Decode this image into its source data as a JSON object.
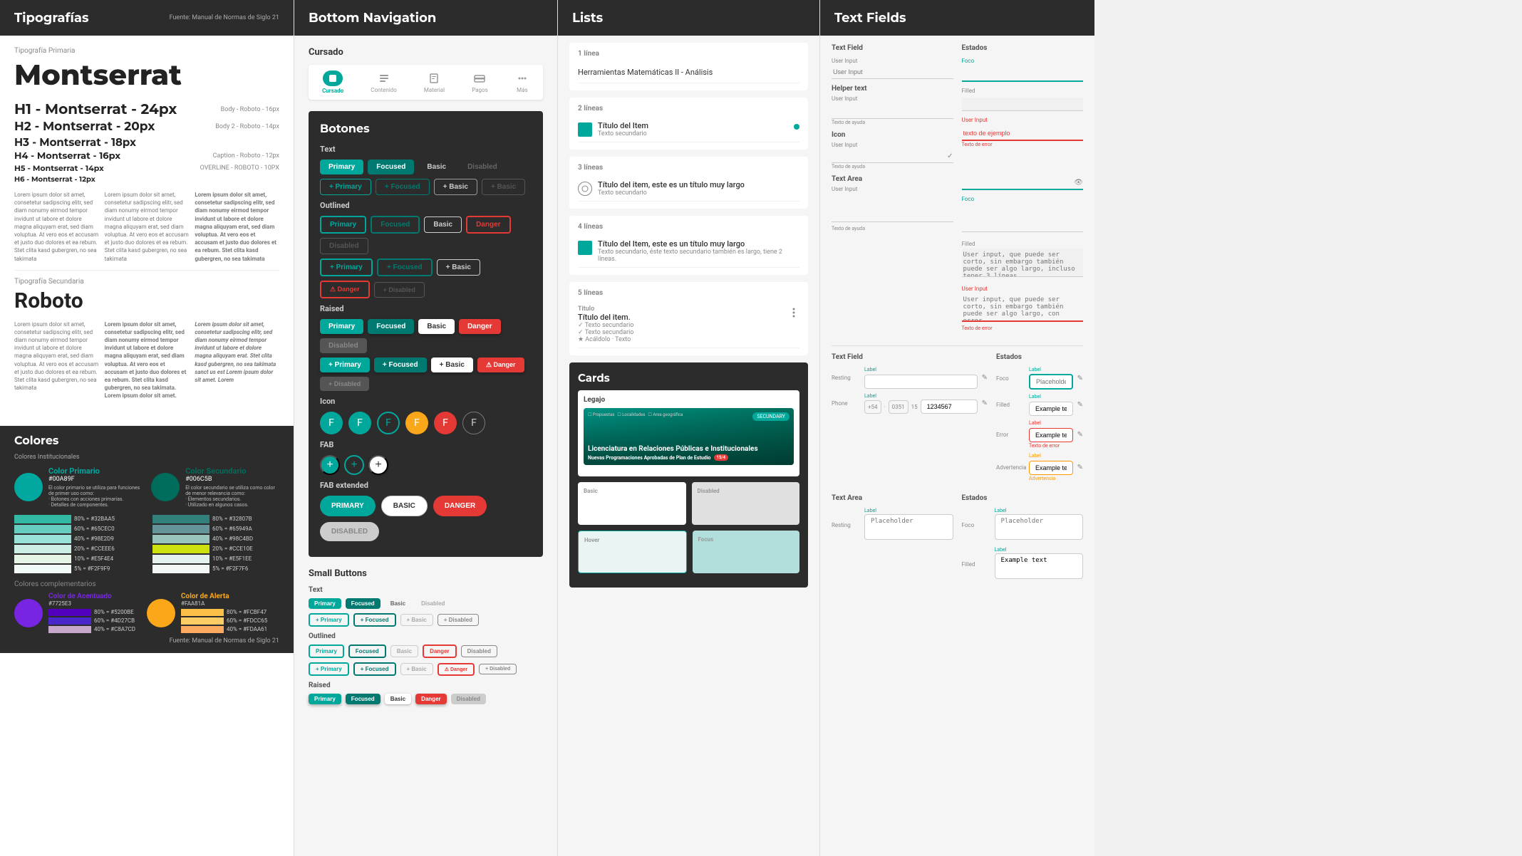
{
  "panel1": {
    "title": "Tipografías",
    "source": "Fuente: Manual de Normas de Siglo 21",
    "primaryLabel": "Tipografía Primaria",
    "primaryFont": "Montserrat",
    "headings": [
      {
        "label": "H1 - Montserrat - 24px",
        "bodyLabel": "Body - Roboto - 16px"
      },
      {
        "label": "H2 - Montserrat - 20px",
        "bodyLabel": "Body 2 - Roboto - 14px"
      },
      {
        "label": "H3 - Montserrat - 18px",
        "bodyLabel": ""
      },
      {
        "label": "H4 - Montserrat - 16px",
        "bodyLabel": "Caption - Roboto - 12px"
      },
      {
        "label": "H5 - Montserrat - 14px",
        "bodyLabel": "OVERLINE - ROBOTO - 10PX"
      },
      {
        "label": "H6 - Montserrat - 12px",
        "bodyLabel": ""
      }
    ],
    "sampleText": "Lorem ipsum dolor sit amet, consetetur sadipscing elitr, sed diam nonumy eirmod tempor invidunt ut labore et dolore magna aliquyam erat, sed diam voluptua. At vero eos et accusam et justo duo dolores et ea rebum. Stet clita kasd gubergren, no sea takimata",
    "secondaryLabel": "Tipografía Secundaria",
    "secondaryFont": "Roboto",
    "coloresTitle": "Colores",
    "coloresSource": "Fuente: Manual de Normas de Siglo 21",
    "institutionalLabel": "Colores Institucionales",
    "primaryColorName": "Color Primario",
    "primaryColorHex": "#00A89F",
    "secondaryColorName": "Color Secundario",
    "secondaryColorHex": "#006C5B",
    "primaryShades": [
      "80% = #32BAA5",
      "60% = #65CEC0",
      "40% = #98E2D9",
      "20% = #CCEEE6",
      "10% = #E5F4E4",
      "5% = #F2F9F9"
    ],
    "secondaryShades": [
      "80% = #32807B",
      "60% = #65949A",
      "40% = #98C4BD",
      "20% = #20% = #CCE10E",
      "10% = #E5F1EE",
      "5% = #F2F7F6"
    ],
    "complementaryLabel": "Colores complementarios",
    "accentColorName": "Color de Acentuado",
    "accentColorHex": "#7725E3",
    "alertColorName": "Color de Alerta",
    "alertColorHex": "#FAA81A",
    "accentShades": [
      "80% = #5200BE",
      "60% = #4927CB",
      "40% = #C8A7CD"
    ],
    "alertShades": [
      "80% = #FCBF47",
      "60% = #FDCC65",
      "40% = #FDAA61"
    ]
  },
  "panel2": {
    "title": "Bottom Navigation",
    "cursadoLabel": "Cursado",
    "navItems": [
      {
        "label": "Cursado",
        "active": true
      },
      {
        "label": "Contenido",
        "active": false
      },
      {
        "label": "Material",
        "active": false
      },
      {
        "label": "Pagos",
        "active": false
      },
      {
        "label": "Más",
        "active": false
      }
    ],
    "botonesTitle": "Botones",
    "textLabel": "Text",
    "outlinedLabel": "Outlined",
    "raisedLabel": "Raised",
    "iconLabel": "Icon",
    "fabLabel": "FAB",
    "fabExtLabel": "FAB extended",
    "smallBtnsLabel": "Small Buttons",
    "smallTextLabel": "Text",
    "smallOutlinedLabel": "Outlined",
    "smallRaisedLabel": "Raised",
    "btnLabels": {
      "primary": "Primary",
      "focused": "Focused",
      "basic": "Basic",
      "disabled": "Disabled",
      "danger": "Danger",
      "fab_primary": "PRIMARY",
      "fab_basic": "BASIC",
      "fab_danger": "DANGER",
      "fab_disabled": "DISABLED"
    }
  },
  "panel3": {
    "title": "Lists",
    "oneLineLabel": "1 línea",
    "twoLinesLabel": "2 líneas",
    "threeLinesLabel": "3 líneas",
    "fourLinesLabel": "4 líneas",
    "fiveLinesLabel": "5 líneas",
    "listItem1": "Herramientas Matemáticas II - Análisis",
    "listItem2Title": "Título del Item",
    "listItem2Sub": "Texto secundario",
    "listItem3Title": "Título del item, este es un título muy largo",
    "listItem3Sub": "Texto secundario",
    "listItem4Title": "Título del Item, este es un título muy largo",
    "listItem4Sub": "Texto secundario, éste texto secundario también es largo, tiene 2 líneas.",
    "listItem5Title": "Titulo",
    "listItem5Sub": "Título del item.",
    "listItem5Sub2": "✓ Texto secundario",
    "listItem5Sub3": "✓ Texto secundario",
    "listItem5Sub4": "★ Acáldolo · Texto",
    "cardsTitle": "Cards",
    "legajoLabel": "Legajo",
    "cardTitle": "Licenciatura en Relaciones Públicas e Institucionales",
    "cardSubtitle": "Nuevas Programaciones Aprobadas de Plan de Estudio",
    "cardBadge": "SECUNDARY",
    "cardBadge2": "15/4",
    "basicLabel": "Basic",
    "disabledLabel": "Disabled",
    "hoverLabel": "Hover",
    "focusLabel": "Focus",
    "checkboxItems": [
      "☐ Propuestas",
      "☐ Localidades",
      "☐ Area geográfica"
    ]
  },
  "panel4": {
    "title": "Text Fields",
    "textFieldLabel": "Text Field",
    "estadosLabel": "Estados",
    "focusLabel": "Foco",
    "filledLabel": "Filled",
    "errorLabel": "Error",
    "helperTextLabel": "Helper text",
    "iconSectionLabel": "Icon",
    "textAreaLabel": "Text Area",
    "userInputPlaceholder": "User Input",
    "textExampleLabel": "texto de ejemplo",
    "textOfError": "Texto de error",
    "helperLabel": "Texto de ayuda",
    "labelText": "Label",
    "placeholderText": "Placeholder",
    "exampleText": "Example text",
    "warningText": "Advertencia",
    "resting": "Resting",
    "phone": "Phone",
    "phonePrefix": "+54",
    "phoneSep1": "0351",
    "phoneSep2": "15",
    "phoneNum": "1234567"
  }
}
